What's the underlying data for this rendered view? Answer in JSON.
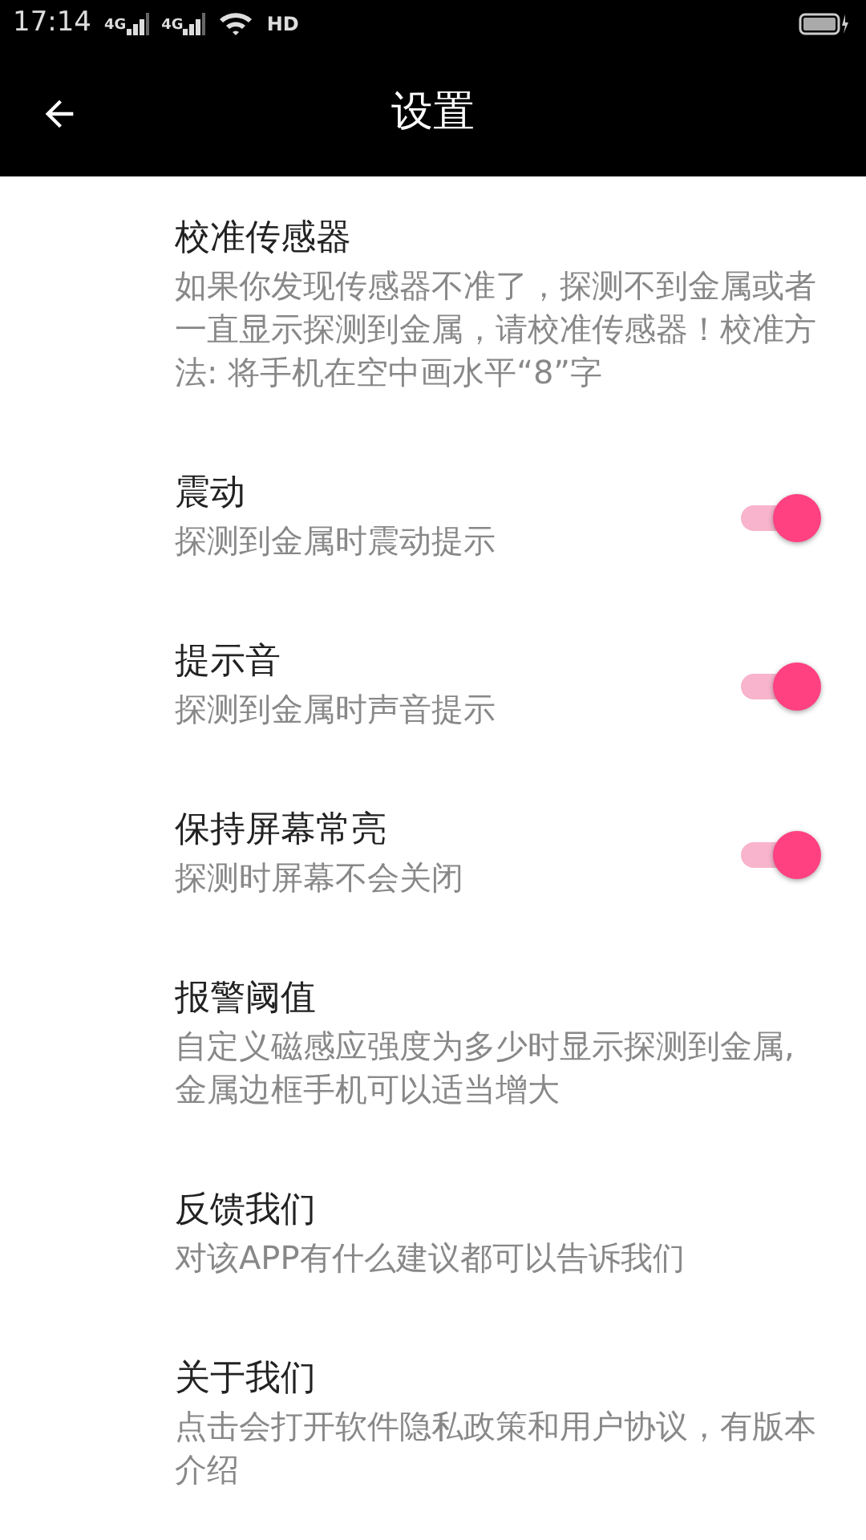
{
  "status_bar": {
    "time": "17:14",
    "network_labels": [
      "4G",
      "4G"
    ],
    "hd_label": "HD"
  },
  "toolbar": {
    "title": "设置"
  },
  "settings": [
    {
      "kind": "text",
      "title": "校准传感器",
      "description": "如果你发现传感器不准了，探测不到金属或者一直显示探测到金属，请校准传感器！校准方法: 将手机在空中画水平“8”字"
    },
    {
      "kind": "switch",
      "title": "震动",
      "description": "探测到金属时震动提示",
      "on": true
    },
    {
      "kind": "switch",
      "title": "提示音",
      "description": "探测到金属时声音提示",
      "on": true
    },
    {
      "kind": "switch",
      "title": "保持屏幕常亮",
      "description": "探测时屏幕不会关闭",
      "on": true
    },
    {
      "kind": "text",
      "title": "报警阈值",
      "description": "自定义磁感应强度为多少时显示探测到金属,金属边框手机可以适当增大"
    },
    {
      "kind": "text",
      "title": "反馈我们",
      "description": "对该APP有什么建议都可以告诉我们"
    },
    {
      "kind": "text",
      "title": "关于我们",
      "description": "点击会打开软件隐私政策和用户协议，有版本介绍"
    }
  ]
}
